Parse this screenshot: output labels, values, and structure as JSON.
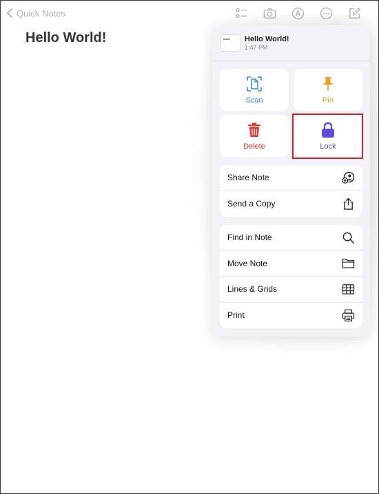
{
  "topbar": {
    "back_label": "Quick Notes",
    "icons": [
      "checklist-icon",
      "camera-icon",
      "markup-icon",
      "more-icon",
      "compose-icon"
    ]
  },
  "note": {
    "title": "Hello World!"
  },
  "menu": {
    "header": {
      "title": "Hello World!",
      "time": "1:47 PM"
    },
    "tiles": [
      {
        "label": "Scan",
        "icon": "scan-icon",
        "color": "#2f8fd8"
      },
      {
        "label": "Pin",
        "icon": "pin-icon",
        "color": "#f0a21a"
      },
      {
        "label": "Delete",
        "icon": "trash-icon",
        "color": "#e5352f"
      },
      {
        "label": "Lock",
        "icon": "lock-icon",
        "color": "#5b4ed9"
      }
    ],
    "group1": [
      {
        "label": "Share Note",
        "icon": "share-note-icon"
      },
      {
        "label": "Send a Copy",
        "icon": "share-icon"
      }
    ],
    "group2": [
      {
        "label": "Find in Note",
        "icon": "search-icon"
      },
      {
        "label": "Move Note",
        "icon": "folder-icon"
      },
      {
        "label": "Lines & Grids",
        "icon": "grid-icon"
      },
      {
        "label": "Print",
        "icon": "print-icon"
      }
    ]
  },
  "colors": {
    "highlight": "#d21f26",
    "toolbar_icon": "#b3b3b8"
  }
}
